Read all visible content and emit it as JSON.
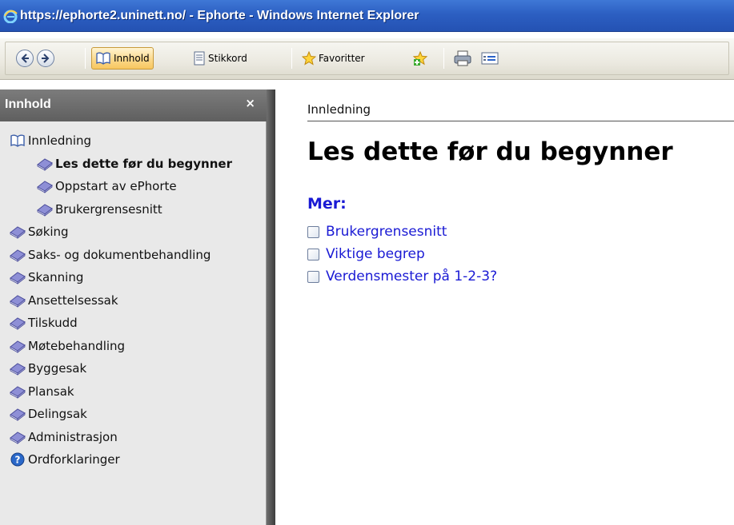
{
  "window": {
    "title": "https://ephorte2.uninett.no/ - Ephorte - Windows Internet Explorer"
  },
  "toolbar": {
    "back_icon": "back-arrow-icon",
    "forward_icon": "forward-arrow-icon",
    "contents_label": "Innhold",
    "index_label": "Stikkord",
    "favorites_label": "Favoritter",
    "colors": {
      "active_tab": "#f7c65f"
    }
  },
  "sidebar": {
    "title": "Innhold",
    "close_glyph": "×",
    "items": [
      {
        "label": "Innledning",
        "icon": "open-book-icon",
        "level": 0,
        "bold": false
      },
      {
        "label": "Les dette før du begynner",
        "icon": "book-icon",
        "level": 1,
        "bold": true
      },
      {
        "label": "Oppstart av ePhorte",
        "icon": "book-icon",
        "level": 1,
        "bold": false
      },
      {
        "label": "Brukergrensesnitt",
        "icon": "book-icon",
        "level": 1,
        "bold": false
      },
      {
        "label": "Søking",
        "icon": "book-icon",
        "level": 0,
        "bold": false
      },
      {
        "label": "Saks- og dokumentbehandling",
        "icon": "book-icon",
        "level": 0,
        "bold": false
      },
      {
        "label": "Skanning",
        "icon": "book-icon",
        "level": 0,
        "bold": false
      },
      {
        "label": "Ansettelsessak",
        "icon": "book-icon",
        "level": 0,
        "bold": false
      },
      {
        "label": "Tilskudd",
        "icon": "book-icon",
        "level": 0,
        "bold": false
      },
      {
        "label": "Møtebehandling",
        "icon": "book-icon",
        "level": 0,
        "bold": false
      },
      {
        "label": "Byggesak",
        "icon": "book-icon",
        "level": 0,
        "bold": false
      },
      {
        "label": "Plansak",
        "icon": "book-icon",
        "level": 0,
        "bold": false
      },
      {
        "label": "Delingsak",
        "icon": "book-icon",
        "level": 0,
        "bold": false
      },
      {
        "label": "Administrasjon",
        "icon": "book-icon",
        "level": 0,
        "bold": false
      },
      {
        "label": "Ordforklaringer",
        "icon": "help-icon",
        "level": 0,
        "bold": false
      }
    ]
  },
  "main": {
    "breadcrumb": "Innledning",
    "title": "Les dette før du begynner",
    "more_label": "Mer:",
    "links": [
      "Brukergrensesnitt",
      "Viktige begrep",
      "Verdensmester på 1-2-3?"
    ],
    "colors": {
      "link": "#1a1ad4"
    }
  }
}
